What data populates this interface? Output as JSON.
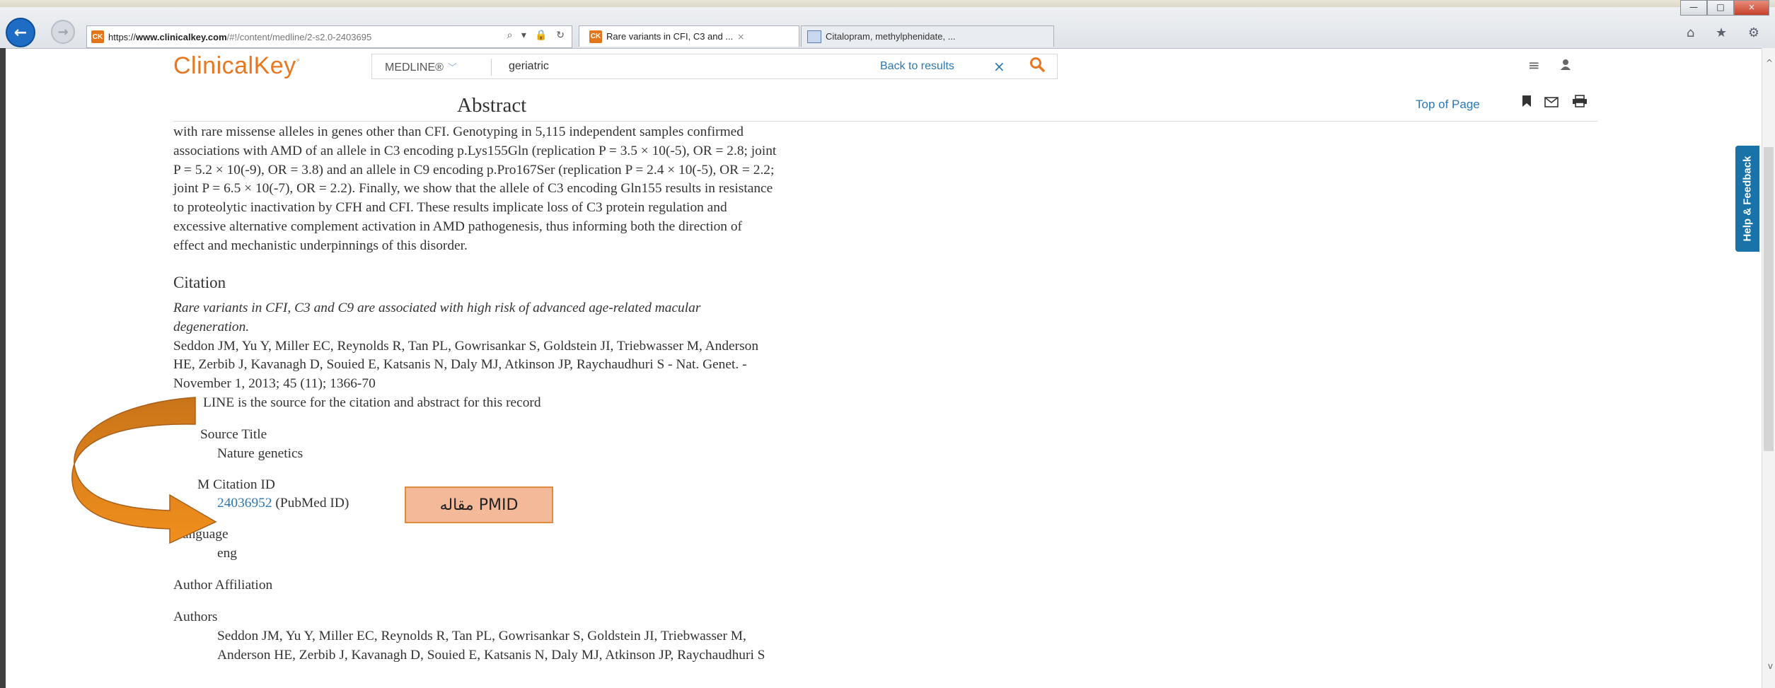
{
  "browser": {
    "url_scheme": "https://",
    "url_host": "www.clinicalkey.com",
    "url_rest": "/#!/content/medline/2-s2.0-2403695",
    "address_icons": "⌕ ▾ 🔒 ↻",
    "favicon_text": "CK",
    "tabs": [
      {
        "label": "Rare variants in CFI, C3 and ...",
        "close": "×",
        "active": true
      },
      {
        "label": "Citalopram, methylphenidate, ...",
        "active": false
      }
    ],
    "window_controls": {
      "minimize": "—",
      "maximize": "□",
      "close": "×"
    },
    "right_icons": "⌂ ★ ⚙"
  },
  "header": {
    "logo": "ClinicalKey",
    "logo_mark": "°",
    "source": "MEDLINE®",
    "query": "geriatric",
    "back_to_results": "Back to results",
    "clear": "×",
    "search_icon": "magnifier-icon",
    "menu_icon": "≡",
    "user_icon": "▲"
  },
  "section": {
    "title": "Abstract",
    "top_of_page": "Top of Page",
    "icons": [
      "bookmark-icon",
      "email-icon",
      "print-icon"
    ]
  },
  "abstract_lines": [
    "with rare missense alleles in genes other than CFI. Genotyping in 5,115 independent samples confirmed",
    "associations with AMD of an allele in C3 encoding p.Lys155Gln (replication P = 3.5 × 10(-5), OR = 2.8; joint",
    "P = 5.2 × 10(-9), OR = 3.8) and an allele in C9 encoding p.Pro167Ser (replication P = 2.4 × 10(-5), OR = 2.2;",
    "joint P = 6.5 × 10(-7), OR = 2.2). Finally, we show that the allele of C3 encoding Gln155 results in resistance",
    "to proteolytic inactivation by CFH and CFI. These results implicate loss of C3 protein regulation and",
    "excessive alternative complement activation in AMD pathogenesis, thus informing both the direction of",
    "effect and mechanistic underpinnings of this disorder."
  ],
  "citation": {
    "heading": "Citation",
    "title_line1": "Rare variants in CFI, C3 and C9 are associated with high risk of advanced age-related macular",
    "title_line2": "degeneration.",
    "authors_line1": "Seddon JM, Yu Y, Miller EC, Reynolds R, Tan PL, Gowrisankar S, Goldstein JI, Triebwasser M, Anderson",
    "authors_line2": "HE, Zerbib J, Kavanagh D, Souied E, Katsanis N, Daly MJ, Atkinson JP, Raychaudhuri S - Nat. Genet. -",
    "authors_line3": "November 1, 2013; 45 (11); 1366-70",
    "source_note": "LINE is the source for the citation and abstract for this record"
  },
  "fields": {
    "full_source_label": "Source Title",
    "full_source_value": "Nature genetics",
    "citation_id_label": "M Citation ID",
    "pmid": "24036952",
    "pmid_suffix": " (PubMed ID)",
    "language_label": "anguage",
    "language_value": "eng",
    "affiliation_label": "Author Affiliation",
    "authors_label": "Authors",
    "authors_line1": "Seddon JM, Yu Y, Miller EC, Reynolds R, Tan PL, Gowrisankar S, Goldstein JI, Triebwasser M,",
    "authors_line2": "Anderson HE, Zerbib J, Kavanagh D, Souied E, Katsanis N, Daly MJ, Atkinson JP, Raychaudhuri S"
  },
  "help_tab": "Help & Feedback",
  "callout": "مقاله PMID",
  "colors": {
    "brand_orange": "#e87722",
    "link_blue": "#2a78b4",
    "arrow_orange": "#e8901f",
    "callout_fill": "#f4b999"
  }
}
